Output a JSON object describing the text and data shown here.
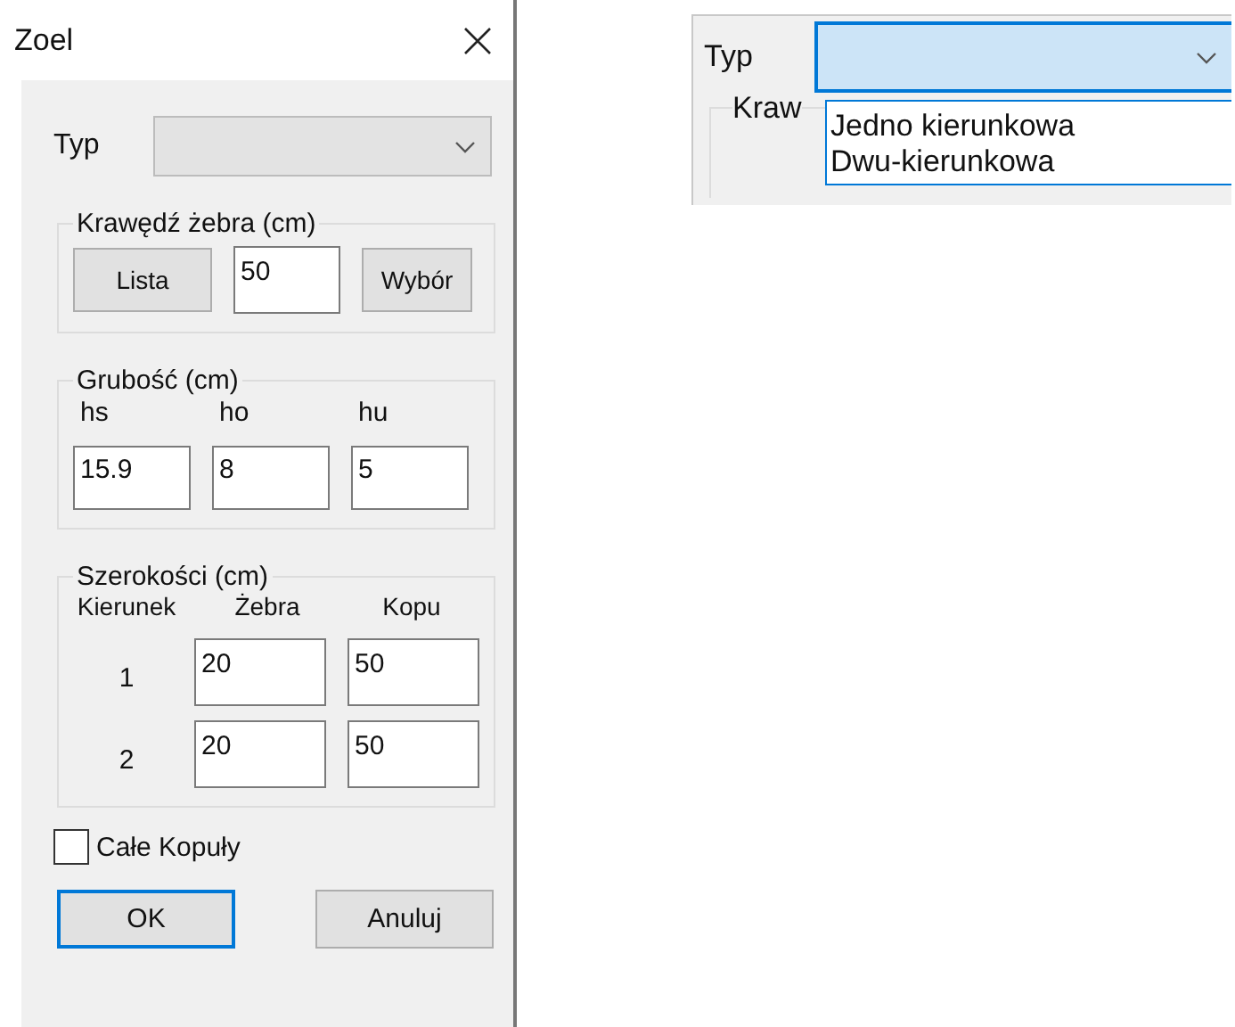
{
  "dialog": {
    "title": "Zoel",
    "type_field": {
      "label": "Typ",
      "disabled": true
    },
    "edge_group": {
      "title": "Krawędź żebra (cm)",
      "buttons": [
        "Lista",
        "Wybór"
      ],
      "value": "50"
    },
    "thickness_group": {
      "title": "Grubość (cm)",
      "fields": [
        {
          "label": "hs",
          "value": "15.9"
        },
        {
          "label": "ho",
          "value": "8"
        },
        {
          "label": "hu",
          "value": "5"
        }
      ]
    },
    "widths_group": {
      "title": "Szerokości (cm)",
      "columns": [
        "Kierunek",
        "Żebra",
        "Kopu"
      ],
      "rows": [
        {
          "direction": "1",
          "rib": "20",
          "dome": "50"
        },
        {
          "direction": "2",
          "rib": "20",
          "dome": "50"
        }
      ]
    },
    "checkbox": {
      "label": "Całe Kopuły",
      "checked": false
    },
    "buttons": [
      {
        "label": "OK",
        "default": true
      },
      {
        "label": "Anuluj",
        "default": false
      }
    ]
  },
  "dropdown_inset": {
    "label": "Typ",
    "group_label": "Kraw",
    "expanded": true,
    "options": [
      {
        "label": "Jedno kierunkowa",
        "selected": false
      },
      {
        "label": "Dwu-kierunkowa",
        "selected": false
      }
    ]
  }
}
